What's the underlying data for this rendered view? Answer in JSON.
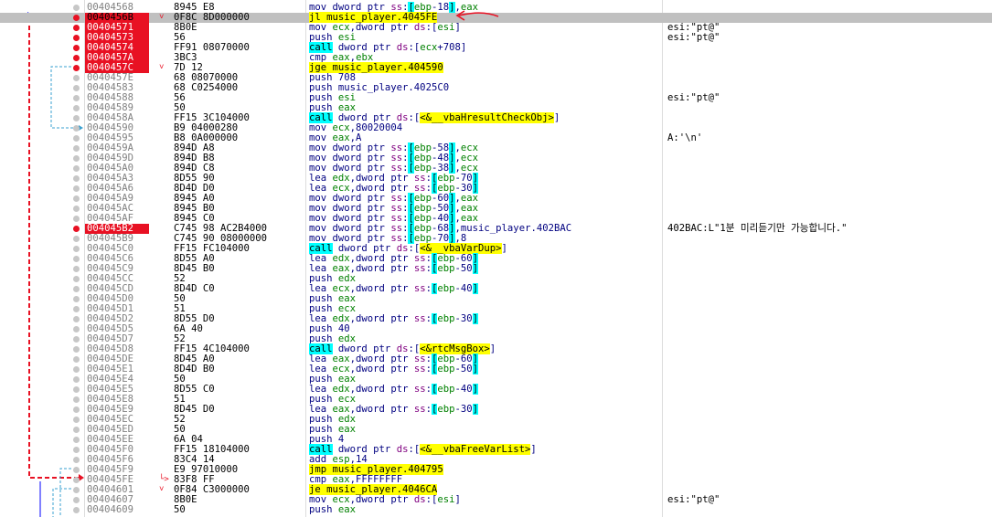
{
  "colors": {
    "breakpoint": "#e81123",
    "current_row": "#c0c0c0",
    "jump_highlight": "#ffff00",
    "call_highlight": "#00ffff",
    "address_text": "#808080"
  },
  "icons": {
    "breakpoint_dot": "breakpoint-dot-icon",
    "jump_arrow": "jump-arrow-icon",
    "pointer_arrow": "red-pointer-arrow-icon"
  },
  "rows": [
    {
      "addr": "00404568",
      "bytes": "8945 E8",
      "instr": "mov dword ptr ss:[ebp-18],eax",
      "comment": "",
      "bp": false,
      "current": false,
      "jm": ""
    },
    {
      "addr": "0040456B",
      "bytes": "0F8C 8D000000",
      "instr": "jl music_player.4045FE",
      "comment": "",
      "bp": true,
      "current": true,
      "jm": "v"
    },
    {
      "addr": "00404571",
      "bytes": "8B0E",
      "instr": "mov ecx,dword ptr ds:[esi]",
      "comment": "esi:\"pt@\"",
      "bp": true,
      "current": false,
      "jm": ""
    },
    {
      "addr": "00404573",
      "bytes": "56",
      "instr": "push esi",
      "comment": "esi:\"pt@\"",
      "bp": true,
      "current": false,
      "jm": ""
    },
    {
      "addr": "00404574",
      "bytes": "FF91 08070000",
      "instr": "call dword ptr ds:[ecx+708]",
      "comment": "",
      "bp": true,
      "current": false,
      "jm": ""
    },
    {
      "addr": "0040457A",
      "bytes": "3BC3",
      "instr": "cmp eax,ebx",
      "comment": "",
      "bp": true,
      "current": false,
      "jm": ""
    },
    {
      "addr": "0040457C",
      "bytes": "7D 12",
      "instr": "jge music_player.404590",
      "comment": "",
      "bp": true,
      "current": false,
      "jm": "v"
    },
    {
      "addr": "0040457E",
      "bytes": "68 08070000",
      "instr": "push 708",
      "comment": "",
      "bp": false,
      "current": false,
      "jm": ""
    },
    {
      "addr": "00404583",
      "bytes": "68 C0254000",
      "instr": "push music_player.4025C0",
      "comment": "",
      "bp": false,
      "current": false,
      "jm": ""
    },
    {
      "addr": "00404588",
      "bytes": "56",
      "instr": "push esi",
      "comment": "esi:\"pt@\"",
      "bp": false,
      "current": false,
      "jm": ""
    },
    {
      "addr": "00404589",
      "bytes": "50",
      "instr": "push eax",
      "comment": "",
      "bp": false,
      "current": false,
      "jm": ""
    },
    {
      "addr": "0040458A",
      "bytes": "FF15 3C104000",
      "instr": "call dword ptr ds:[<&__vbaHresultCheckObj>]",
      "comment": "",
      "bp": false,
      "current": false,
      "jm": ""
    },
    {
      "addr": "00404590",
      "bytes": "B9 04000280",
      "instr": "mov ecx,80020004",
      "comment": "",
      "bp": false,
      "current": false,
      "jm": ""
    },
    {
      "addr": "00404595",
      "bytes": "B8 0A000000",
      "instr": "mov eax,A",
      "comment": "A:'\\n'",
      "bp": false,
      "current": false,
      "jm": ""
    },
    {
      "addr": "0040459A",
      "bytes": "894D A8",
      "instr": "mov dword ptr ss:[ebp-58],ecx",
      "comment": "",
      "bp": false,
      "current": false,
      "jm": ""
    },
    {
      "addr": "0040459D",
      "bytes": "894D B8",
      "instr": "mov dword ptr ss:[ebp-48],ecx",
      "comment": "",
      "bp": false,
      "current": false,
      "jm": ""
    },
    {
      "addr": "004045A0",
      "bytes": "894D C8",
      "instr": "mov dword ptr ss:[ebp-38],ecx",
      "comment": "",
      "bp": false,
      "current": false,
      "jm": ""
    },
    {
      "addr": "004045A3",
      "bytes": "8D55 90",
      "instr": "lea edx,dword ptr ss:[ebp-70]",
      "comment": "",
      "bp": false,
      "current": false,
      "jm": ""
    },
    {
      "addr": "004045A6",
      "bytes": "8D4D D0",
      "instr": "lea ecx,dword ptr ss:[ebp-30]",
      "comment": "",
      "bp": false,
      "current": false,
      "jm": ""
    },
    {
      "addr": "004045A9",
      "bytes": "8945 A0",
      "instr": "mov dword ptr ss:[ebp-60],eax",
      "comment": "",
      "bp": false,
      "current": false,
      "jm": ""
    },
    {
      "addr": "004045AC",
      "bytes": "8945 B0",
      "instr": "mov dword ptr ss:[ebp-50],eax",
      "comment": "",
      "bp": false,
      "current": false,
      "jm": ""
    },
    {
      "addr": "004045AF",
      "bytes": "8945 C0",
      "instr": "mov dword ptr ss:[ebp-40],eax",
      "comment": "",
      "bp": false,
      "current": false,
      "jm": ""
    },
    {
      "addr": "004045B2",
      "bytes": "C745 98 AC2B4000",
      "instr": "mov dword ptr ss:[ebp-68],music_player.402BAC",
      "comment": "402BAC:L\"1분 미리듣기만 가능합니다.\"",
      "bp": true,
      "current": false,
      "jm": ""
    },
    {
      "addr": "004045B9",
      "bytes": "C745 90 08000000",
      "instr": "mov dword ptr ss:[ebp-70],8",
      "comment": "",
      "bp": false,
      "current": false,
      "jm": ""
    },
    {
      "addr": "004045C0",
      "bytes": "FF15 FC104000",
      "instr": "call dword ptr ds:[<&__vbaVarDup>]",
      "comment": "",
      "bp": false,
      "current": false,
      "jm": ""
    },
    {
      "addr": "004045C6",
      "bytes": "8D55 A0",
      "instr": "lea edx,dword ptr ss:[ebp-60]",
      "comment": "",
      "bp": false,
      "current": false,
      "jm": ""
    },
    {
      "addr": "004045C9",
      "bytes": "8D45 B0",
      "instr": "lea eax,dword ptr ss:[ebp-50]",
      "comment": "",
      "bp": false,
      "current": false,
      "jm": ""
    },
    {
      "addr": "004045CC",
      "bytes": "52",
      "instr": "push edx",
      "comment": "",
      "bp": false,
      "current": false,
      "jm": ""
    },
    {
      "addr": "004045CD",
      "bytes": "8D4D C0",
      "instr": "lea ecx,dword ptr ss:[ebp-40]",
      "comment": "",
      "bp": false,
      "current": false,
      "jm": ""
    },
    {
      "addr": "004045D0",
      "bytes": "50",
      "instr": "push eax",
      "comment": "",
      "bp": false,
      "current": false,
      "jm": ""
    },
    {
      "addr": "004045D1",
      "bytes": "51",
      "instr": "push ecx",
      "comment": "",
      "bp": false,
      "current": false,
      "jm": ""
    },
    {
      "addr": "004045D2",
      "bytes": "8D55 D0",
      "instr": "lea edx,dword ptr ss:[ebp-30]",
      "comment": "",
      "bp": false,
      "current": false,
      "jm": ""
    },
    {
      "addr": "004045D5",
      "bytes": "6A 40",
      "instr": "push 40",
      "comment": "",
      "bp": false,
      "current": false,
      "jm": ""
    },
    {
      "addr": "004045D7",
      "bytes": "52",
      "instr": "push edx",
      "comment": "",
      "bp": false,
      "current": false,
      "jm": ""
    },
    {
      "addr": "004045D8",
      "bytes": "FF15 4C104000",
      "instr": "call dword ptr ds:[<&rtcMsgBox>]",
      "comment": "",
      "bp": false,
      "current": false,
      "jm": ""
    },
    {
      "addr": "004045DE",
      "bytes": "8D45 A0",
      "instr": "lea eax,dword ptr ss:[ebp-60]",
      "comment": "",
      "bp": false,
      "current": false,
      "jm": ""
    },
    {
      "addr": "004045E1",
      "bytes": "8D4D B0",
      "instr": "lea ecx,dword ptr ss:[ebp-50]",
      "comment": "",
      "bp": false,
      "current": false,
      "jm": ""
    },
    {
      "addr": "004045E4",
      "bytes": "50",
      "instr": "push eax",
      "comment": "",
      "bp": false,
      "current": false,
      "jm": ""
    },
    {
      "addr": "004045E5",
      "bytes": "8D55 C0",
      "instr": "lea edx,dword ptr ss:[ebp-40]",
      "comment": "",
      "bp": false,
      "current": false,
      "jm": ""
    },
    {
      "addr": "004045E8",
      "bytes": "51",
      "instr": "push ecx",
      "comment": "",
      "bp": false,
      "current": false,
      "jm": ""
    },
    {
      "addr": "004045E9",
      "bytes": "8D45 D0",
      "instr": "lea eax,dword ptr ss:[ebp-30]",
      "comment": "",
      "bp": false,
      "current": false,
      "jm": ""
    },
    {
      "addr": "004045EC",
      "bytes": "52",
      "instr": "push edx",
      "comment": "",
      "bp": false,
      "current": false,
      "jm": ""
    },
    {
      "addr": "004045ED",
      "bytes": "50",
      "instr": "push eax",
      "comment": "",
      "bp": false,
      "current": false,
      "jm": ""
    },
    {
      "addr": "004045EE",
      "bytes": "6A 04",
      "instr": "push 4",
      "comment": "",
      "bp": false,
      "current": false,
      "jm": ""
    },
    {
      "addr": "004045F0",
      "bytes": "FF15 18104000",
      "instr": "call dword ptr ds:[<&__vbaFreeVarList>]",
      "comment": "",
      "bp": false,
      "current": false,
      "jm": ""
    },
    {
      "addr": "004045F6",
      "bytes": "83C4 14",
      "instr": "add esp,14",
      "comment": "",
      "bp": false,
      "current": false,
      "jm": ""
    },
    {
      "addr": "004045F9",
      "bytes": "E9 97010000",
      "instr": "jmp music_player.404795",
      "comment": "",
      "bp": false,
      "current": false,
      "jm": ""
    },
    {
      "addr": "004045FE",
      "bytes": "83F8 FF",
      "instr": "cmp eax,FFFFFFFF",
      "comment": "",
      "bp": false,
      "current": false,
      "jm": ">"
    },
    {
      "addr": "00404601",
      "bytes": "0F84 C3000000",
      "instr": "je music_player.4046CA",
      "comment": "",
      "bp": false,
      "current": false,
      "jm": "v"
    },
    {
      "addr": "00404607",
      "bytes": "8B0E",
      "instr": "mov ecx,dword ptr ds:[esi]",
      "comment": "esi:\"pt@\"",
      "bp": false,
      "current": false,
      "jm": ""
    },
    {
      "addr": "00404609",
      "bytes": "50",
      "instr": "push eax",
      "comment": "",
      "bp": false,
      "current": false,
      "jm": ""
    }
  ]
}
